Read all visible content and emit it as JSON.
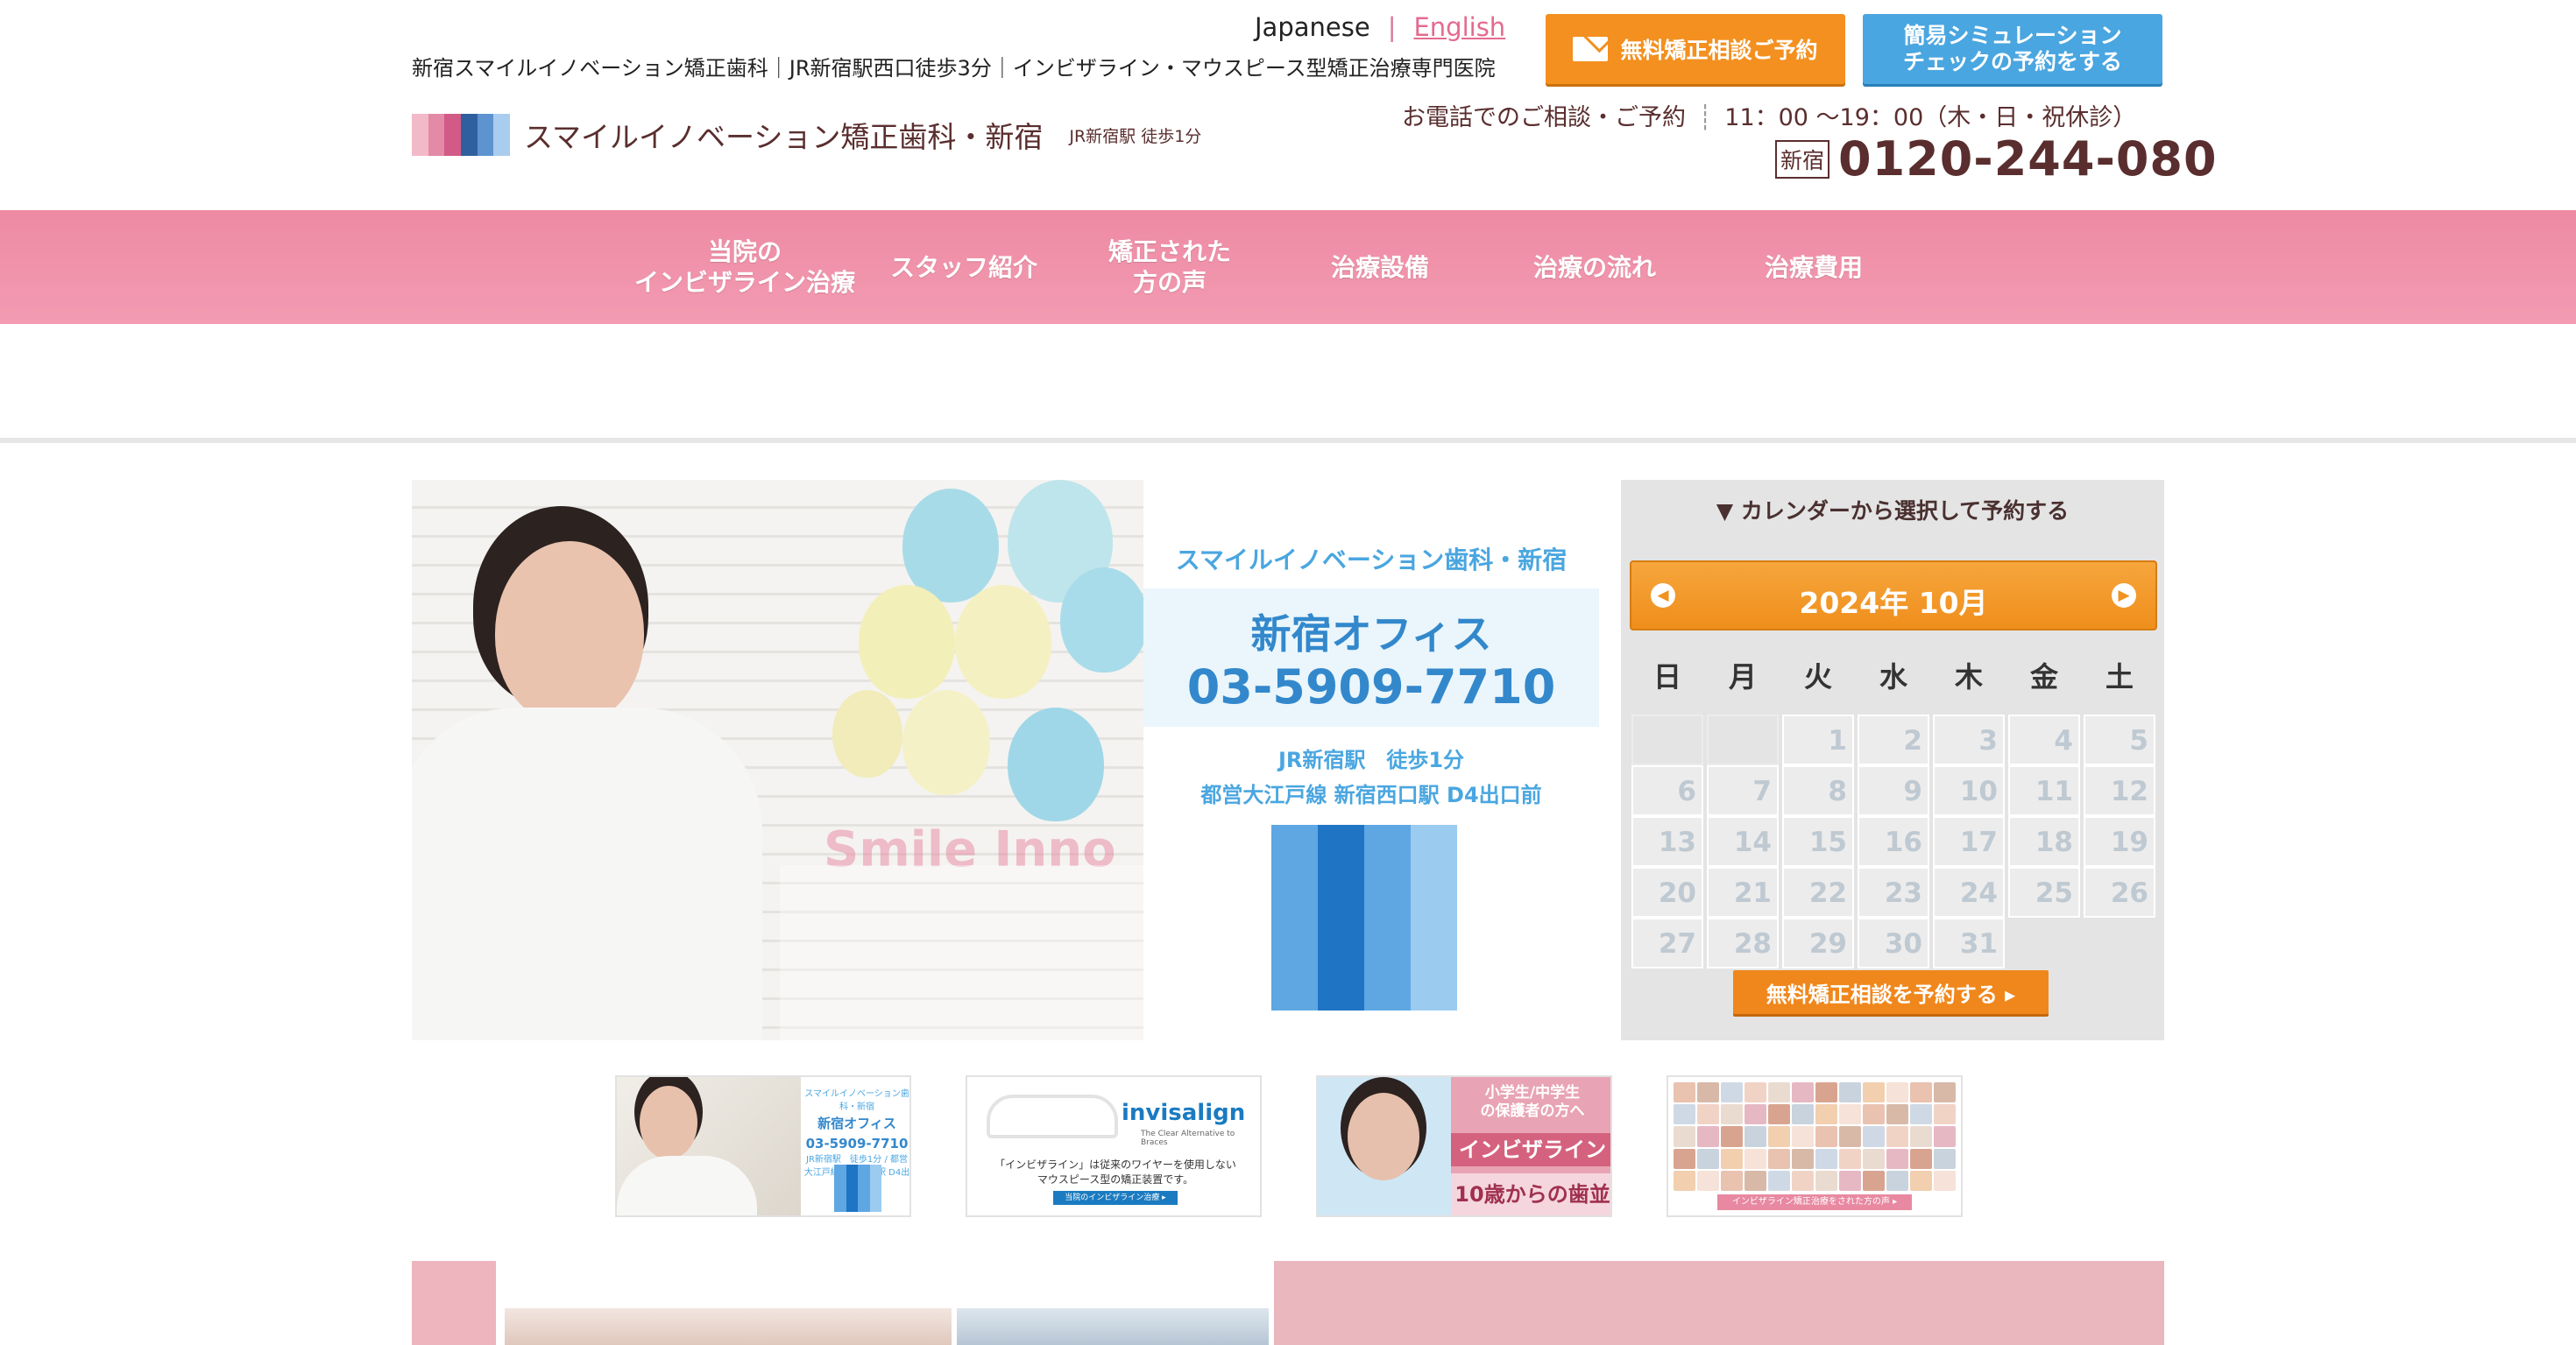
{
  "header": {
    "lang": {
      "japanese": "Japanese",
      "sep": "|",
      "english": "English"
    },
    "tagline": "新宿スマイルイノベーション矯正歯科｜JR新宿駅西口徒歩3分｜インビザライン・マウスピース型矯正治療専門医院",
    "logo_name": "スマイルイノベーション矯正歯科・新宿",
    "logo_sub": "JR新宿駅 徒歩1分",
    "btn_consult": "無料矯正相談ご予約",
    "btn_sim": "簡易シミュレーション\nチェックの予約をする",
    "phone_label": "お電話でのご相談・ご予約",
    "phone_hours": "11：00 〜19：00（木・日・祝休診）",
    "phone_area": "新宿",
    "phone_number": "0120-244-080"
  },
  "nav": [
    {
      "label": "当院の\nインビザライン治療"
    },
    {
      "label": "スタッフ紹介"
    },
    {
      "label": "矯正された\n方の声"
    },
    {
      "label": "治療設備"
    },
    {
      "label": "治療の流れ"
    },
    {
      "label": "治療費用"
    }
  ],
  "hero": {
    "clinic": "スマイルイノベーション歯科・新宿",
    "office": "新宿オフィス",
    "phone": "03-5909-7710",
    "access1": "JR新宿駅　徒歩1分",
    "access2": "都営大江戸線 新宿西口駅 D4出口前",
    "wall_logo": "Smile Inno"
  },
  "calendar": {
    "heading": "▼ カレンダーから選択して予約する",
    "title": "2024年 10月",
    "prev": "◀",
    "next": "▶",
    "dow": [
      "日",
      "月",
      "火",
      "水",
      "木",
      "金",
      "土"
    ],
    "leading_blank": 2,
    "days": [
      1,
      2,
      3,
      4,
      5,
      6,
      7,
      8,
      9,
      10,
      11,
      12,
      13,
      14,
      15,
      16,
      17,
      18,
      19,
      20,
      21,
      22,
      23,
      24,
      25,
      26,
      27,
      28,
      29,
      30,
      31
    ],
    "button": "無料矯正相談を予約する ▸"
  },
  "thumbs": {
    "t1": {
      "clinic": "スマイルイノベーション歯科・新宿",
      "office": "新宿オフィス",
      "phone": "03-5909-7710",
      "access": "JR新宿駅　徒歩1分 / 都営大江戸線 新宿西口駅 D4出口前"
    },
    "t2": {
      "brand": "invisalign",
      "brand_sub": "The Clear Alternative to Braces",
      "desc": "「インビザライン」は従来のワイヤーを使用しない\nマウスピース型の矯正装置です。",
      "link": "当院のインビザライン治療 ▸"
    },
    "t3": {
      "line1": "小学生/中学生\nの保護者の方へ",
      "line2": "インビザライン",
      "line3": "10歳からの歯並び"
    },
    "t4": {
      "bar": "インビザライン矯正治療をされた方の声 ▸"
    }
  },
  "colors": {
    "nav_pink": "#ee8aa3",
    "orange": "#f3901f",
    "blue": "#4aa6e0",
    "brown": "#5a2e2e",
    "logo_stripes": [
      "#f2b9c8",
      "#e38aa6",
      "#d25a86",
      "#2f5f9e",
      "#5d93cf",
      "#a9cdee"
    ],
    "mark_stripes": [
      "#5ea7e3",
      "#1f74c4",
      "#5ea7e3",
      "#9ccbf0"
    ]
  }
}
